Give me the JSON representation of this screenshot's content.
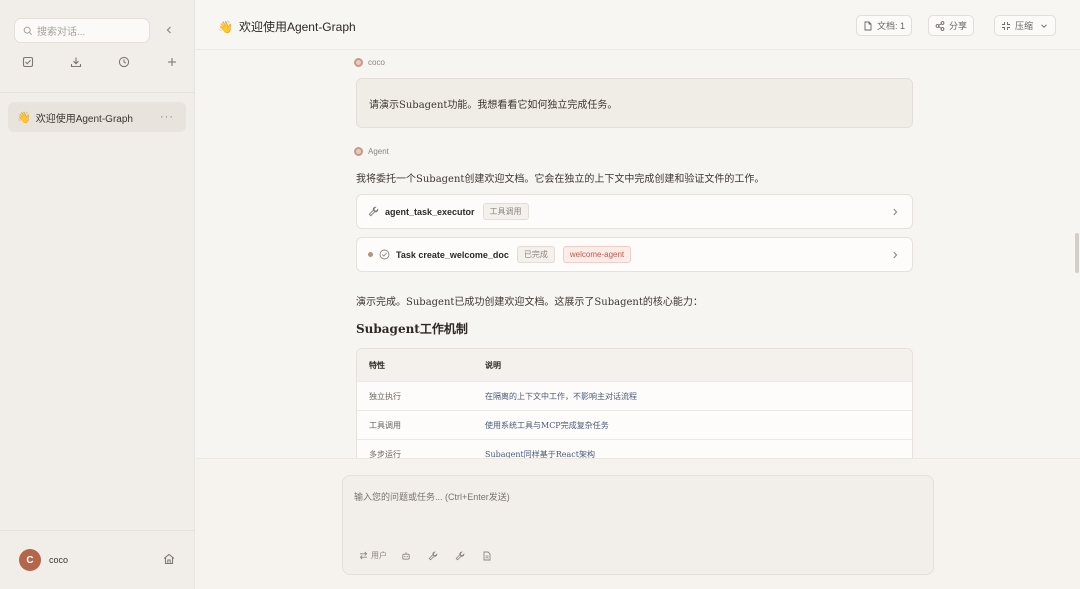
{
  "sidebar": {
    "search_placeholder": "搜索对话...",
    "tool_icons": [
      "checklist-icon",
      "download-icon",
      "history-icon",
      "plus-icon"
    ],
    "conversations": [
      {
        "emoji": "👋",
        "title": "欢迎使用Agent-Graph",
        "more": "···"
      }
    ],
    "user": {
      "initial": "C",
      "name": "coco"
    }
  },
  "header": {
    "emoji": "👋",
    "title": "欢迎使用Agent-Graph",
    "docs_label": "文档: 1",
    "share_label": "分享",
    "compress_label": "压缩"
  },
  "chat": {
    "user_sender": "coco",
    "user_message": "请演示Subagent功能。我想看看它如何独立完成任务。",
    "agent_sender": "Agent",
    "agent_intro": "我将委托一个Subagent创建欢迎文档。它会在独立的上下文中完成创建和验证文件的工作。",
    "tool_call": {
      "name": "agent_task_executor",
      "badge": "工具调用"
    },
    "task": {
      "name": "Task create_welcome_doc",
      "status_badge": "已完成",
      "agent_badge": "welcome-agent"
    },
    "agent_summary": "演示完成。Subagent已成功创建欢迎文档。这展示了Subagent的核心能力：",
    "section_heading": "Subagent工作机制",
    "table": {
      "headers": [
        "特性",
        "说明"
      ],
      "rows": [
        [
          "独立执行",
          "在隔离的上下文中工作，不影响主对话流程"
        ],
        [
          "工具调用",
          "使用系统工具与MCP完成复杂任务"
        ],
        [
          "多步运行",
          "Subagent同样基于React架构"
        ]
      ]
    }
  },
  "input": {
    "placeholder": "输入您的问题或任务... (Ctrl+Enter发送)",
    "mode_label": "用户"
  },
  "colors": {
    "accent": "#b4664a",
    "badge_red": "#c0594a",
    "background": "#f7f5f1"
  }
}
